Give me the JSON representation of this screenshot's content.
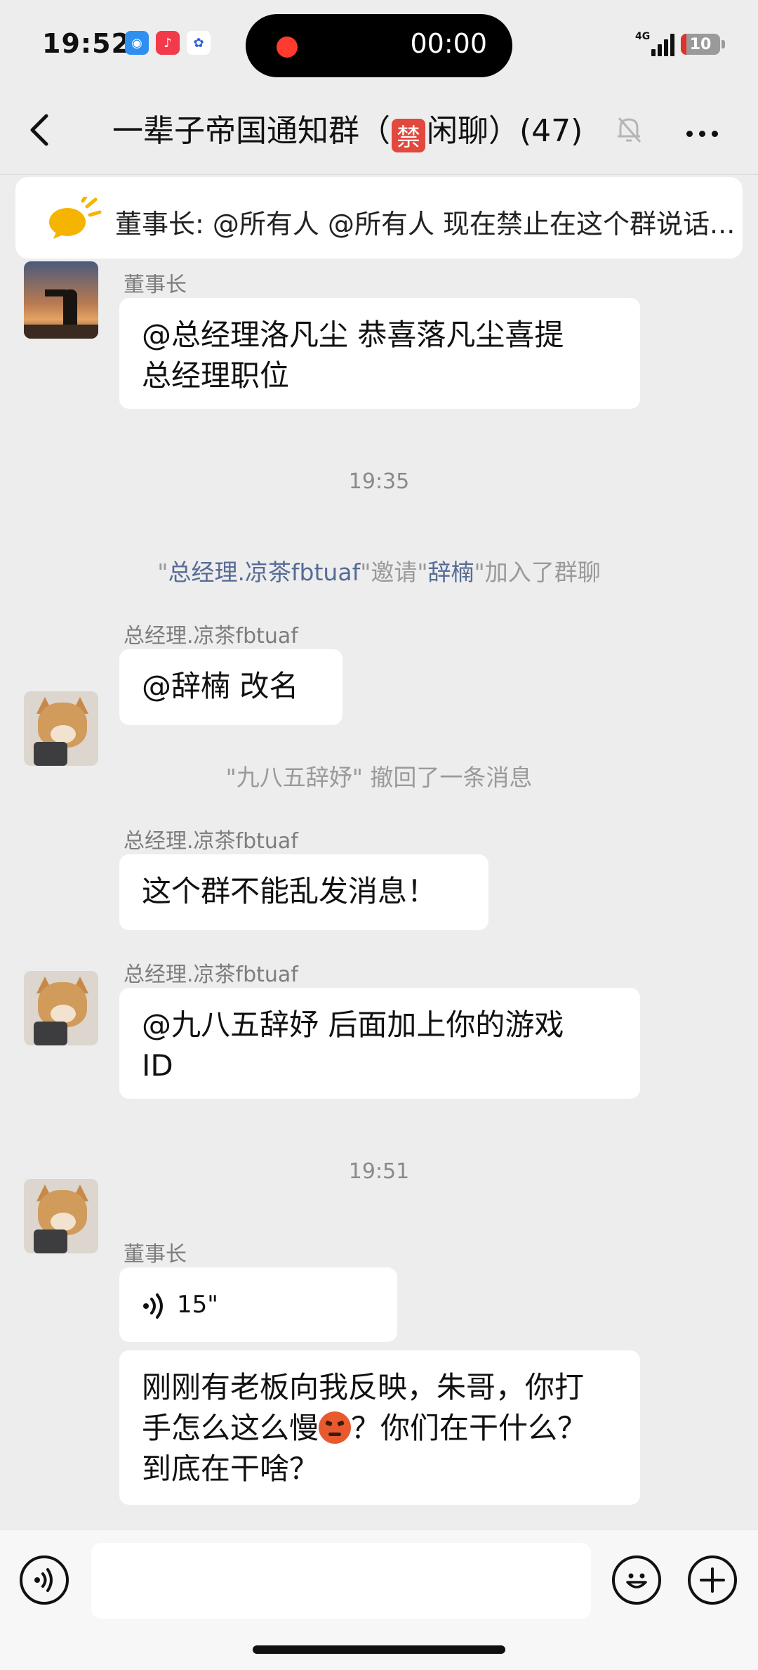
{
  "status_bar": {
    "time": "19:52",
    "recording_time": "00:00",
    "network": "4G",
    "battery": "10",
    "icons": [
      "app-icon-blue",
      "music-icon",
      "baidu-icon"
    ]
  },
  "nav": {
    "title_prefix": "一辈子帝国通知群（",
    "title_badge": "禁",
    "title_suffix": "闲聊）(47)",
    "icons": [
      "back-icon",
      "bell-off-icon",
      "more-icon"
    ]
  },
  "notice": {
    "text": "董事长: @所有人 @所有人 现在禁止在这个群说话..."
  },
  "messages": [
    {
      "sender": "董事长",
      "lines": [
        "@总经理洛凡尘  恭喜落凡尘喜提",
        "总经理职位"
      ]
    },
    {
      "time": "19:35"
    },
    {
      "system_parts": [
        "\"",
        "总经理.凉茶fbtuaf",
        "\"邀请\"",
        "辞楠",
        "\"加入了群聊"
      ]
    },
    {
      "sender": "总经理.凉茶fbtuaf",
      "lines": [
        "@辞楠  改名"
      ]
    },
    {
      "system": "\"九八五辞妤\" 撤回了一条消息"
    },
    {
      "sender": "总经理.凉茶fbtuaf",
      "lines": [
        "这个群不能乱发消息！"
      ]
    },
    {
      "sender": "总经理.凉茶fbtuaf",
      "lines": [
        "@九八五辞妤  后面加上你的游戏",
        "ID"
      ]
    },
    {
      "time": "19:51"
    },
    {
      "sender": "董事长",
      "voice_duration": "15\""
    },
    {
      "lines": [
        "刚刚有老板向我反映，朱哥，你打",
        "手怎么这么慢",
        "？你们在干什么？",
        "到底在干啥？"
      ]
    }
  ],
  "bottom_bar": {
    "input_value": "",
    "icons": [
      "voice-input-icon",
      "emoji-icon",
      "plus-icon"
    ]
  }
}
